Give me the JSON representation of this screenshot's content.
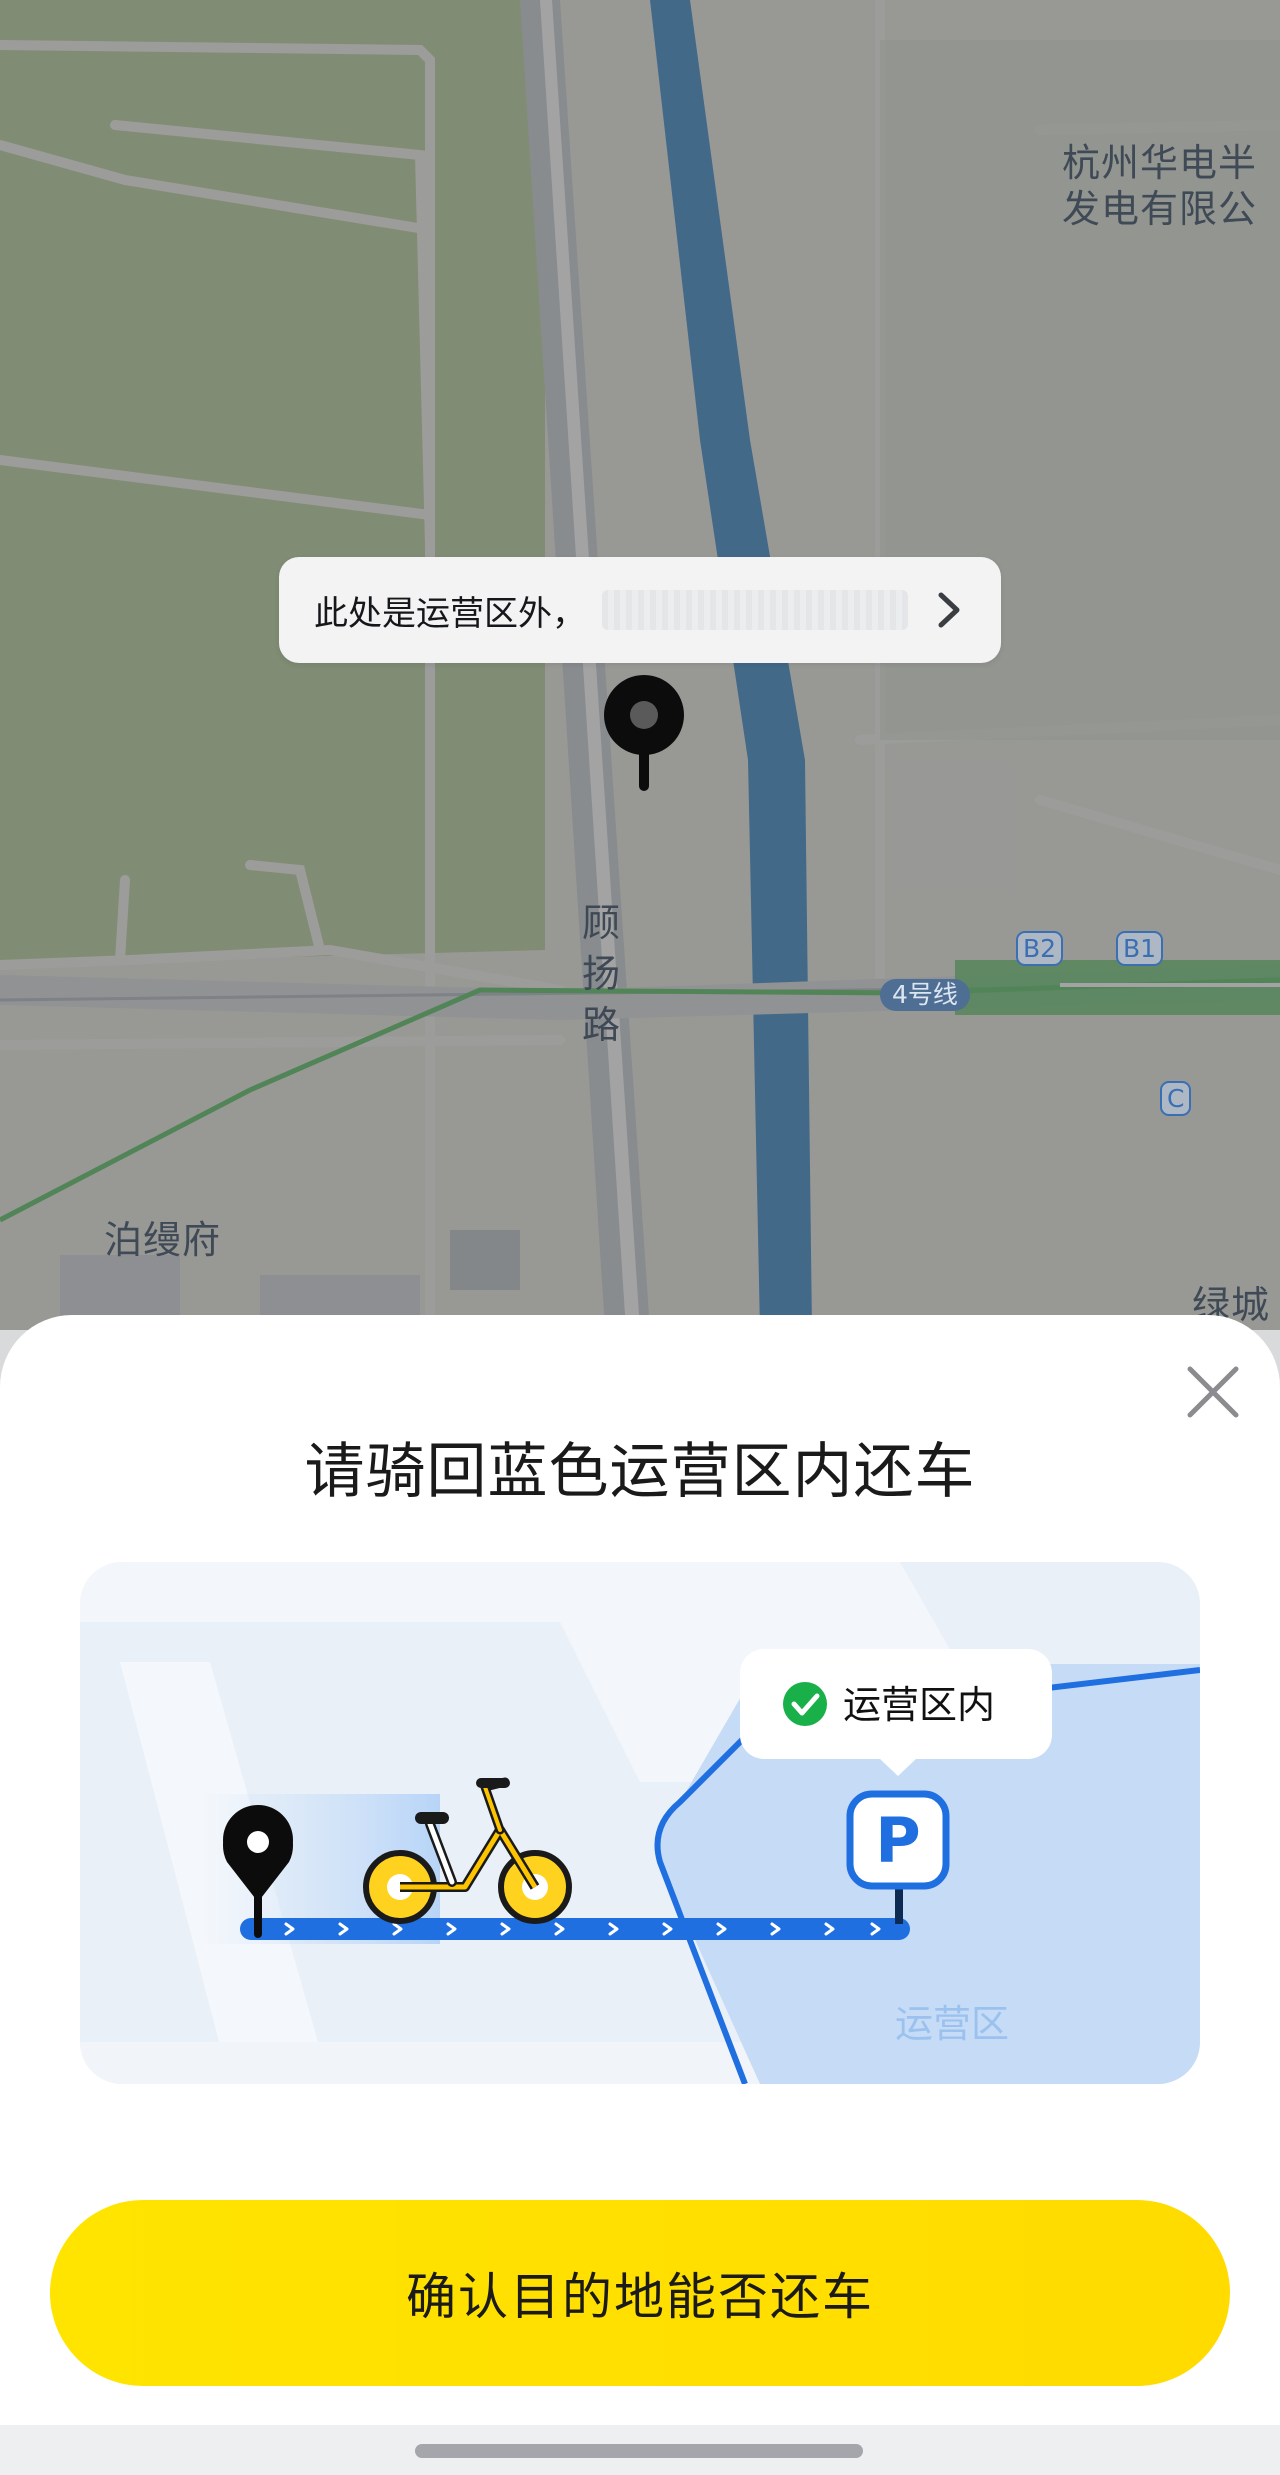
{
  "map": {
    "poi_top_right": "杭州华电半\n发电有限公",
    "road_name": "顾扬路",
    "poi_bottom_left": "泊缦府",
    "poi_bottom_right": "绿城",
    "metro_line": "4号线",
    "exit_b2": "B2",
    "exit_b1": "B1",
    "exit_c": "C"
  },
  "notice": {
    "text": "此处是运营区外，",
    "arrow_icon": "chevron-right-icon"
  },
  "sheet": {
    "title": "请骑回蓝色运营区内还车",
    "close_icon": "close-icon",
    "illustration": {
      "badge_text": "运营区内",
      "zone_label": "运营区",
      "parking_symbol": "P"
    },
    "confirm_button": "确认目的地能否还车"
  },
  "colors": {
    "accent_yellow": "#ffe000",
    "zone_blue": "#1f6fe0",
    "check_green": "#19b04a"
  }
}
